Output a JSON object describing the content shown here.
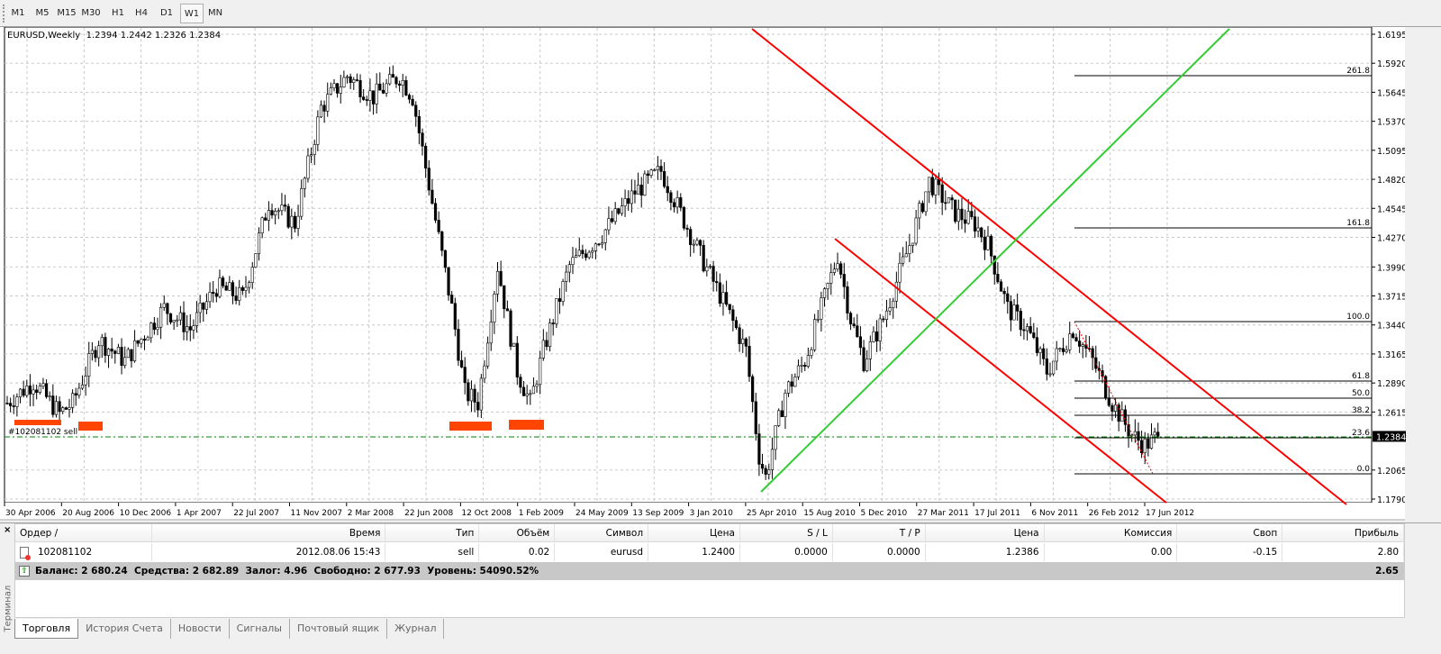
{
  "timeframes": [
    "M1",
    "M5",
    "M15",
    "M30",
    "H1",
    "H4",
    "D1",
    "W1",
    "MN"
  ],
  "active_timeframe": "W1",
  "chart": {
    "symbol": "EURUSD,Weekly",
    "ohlc": "1.2394 1.2442 1.2326 1.2384",
    "price_ticks": [
      "1.6195",
      "1.5920",
      "1.5645",
      "1.5370",
      "1.5095",
      "1.4820",
      "1.4545",
      "1.4270",
      "1.3990",
      "1.3715",
      "1.3440",
      "1.3165",
      "1.2890",
      "1.2615",
      "1.2065",
      "1.1790"
    ],
    "current_price": "1.2384",
    "date_ticks": [
      "30 Apr 2006",
      "20 Aug 2006",
      "10 Dec 2006",
      "1 Apr 2007",
      "22 Jul 2007",
      "11 Nov 2007",
      "2 Mar 2008",
      "22 Jun 2008",
      "12 Oct 2008",
      "1 Feb 2009",
      "24 May 2009",
      "13 Sep 2009",
      "3 Jan 2010",
      "25 Apr 2010",
      "15 Aug 2010",
      "5 Dec 2010",
      "27 Mar 2011",
      "17 Jul 2011",
      "6 Nov 2011",
      "26 Feb 2012",
      "17 Jun 2012"
    ],
    "order_label": "#102081102 sell",
    "fib_levels": [
      "261.8",
      "161.8",
      "100.0",
      "61.8",
      "50.0",
      "38.2",
      "23.6",
      "0.0"
    ],
    "price_path_weeks": [
      [
        0,
        1.27
      ],
      [
        8,
        1.29
      ],
      [
        16,
        1.26
      ],
      [
        20,
        1.27
      ],
      [
        28,
        1.33
      ],
      [
        36,
        1.31
      ],
      [
        48,
        1.36
      ],
      [
        56,
        1.34
      ],
      [
        64,
        1.38
      ],
      [
        72,
        1.37
      ],
      [
        80,
        1.46
      ],
      [
        88,
        1.44
      ],
      [
        96,
        1.55
      ],
      [
        104,
        1.58
      ],
      [
        112,
        1.56
      ],
      [
        120,
        1.58
      ],
      [
        124,
        1.56
      ],
      [
        130,
        1.46
      ],
      [
        136,
        1.36
      ],
      [
        140,
        1.28
      ],
      [
        144,
        1.27
      ],
      [
        150,
        1.4
      ],
      [
        156,
        1.3
      ],
      [
        160,
        1.27
      ],
      [
        164,
        1.32
      ],
      [
        172,
        1.4
      ],
      [
        182,
        1.43
      ],
      [
        192,
        1.47
      ],
      [
        200,
        1.49
      ],
      [
        206,
        1.45
      ],
      [
        212,
        1.41
      ],
      [
        220,
        1.36
      ],
      [
        226,
        1.32
      ],
      [
        230,
        1.22
      ],
      [
        232,
        1.2
      ],
      [
        238,
        1.28
      ],
      [
        244,
        1.31
      ],
      [
        250,
        1.37
      ],
      [
        254,
        1.41
      ],
      [
        258,
        1.35
      ],
      [
        262,
        1.31
      ],
      [
        268,
        1.35
      ],
      [
        276,
        1.42
      ],
      [
        282,
        1.48
      ],
      [
        290,
        1.45
      ],
      [
        296,
        1.44
      ],
      [
        300,
        1.42
      ],
      [
        306,
        1.36
      ],
      [
        312,
        1.34
      ],
      [
        318,
        1.3
      ],
      [
        322,
        1.32
      ],
      [
        326,
        1.34
      ],
      [
        332,
        1.31
      ],
      [
        338,
        1.27
      ],
      [
        344,
        1.24
      ],
      [
        348,
        1.23
      ],
      [
        352,
        1.2384
      ]
    ]
  },
  "terminal": {
    "side_label": "Терминал",
    "columns": [
      "Ордер  /",
      "Время",
      "Тип",
      "Объём",
      "Символ",
      "Цена",
      "S / L",
      "T / P",
      "Цена",
      "Комиссия",
      "Своп",
      "Прибыль"
    ],
    "orders": [
      [
        "102081102",
        "2012.08.06 15:43",
        "sell",
        "0.02",
        "eurusd",
        "1.2400",
        "0.0000",
        "0.0000",
        "1.2386",
        "0.00",
        "-0.15",
        "2.80"
      ]
    ],
    "balance_line": "Баланс: 2 680.24  Средства: 2 682.89  Залог: 4.96  Свободно: 2 677.93  Уровень: 54090.52%",
    "total_profit": "2.65",
    "tabs": [
      "Торговля",
      "История Счета",
      "Новости",
      "Сигналы",
      "Почтовый ящик",
      "Журнал"
    ]
  },
  "colors": {
    "channel": "#ff0000",
    "trend": "#32cd32",
    "order_line": "#008000",
    "support_zone": "#ff4500"
  }
}
